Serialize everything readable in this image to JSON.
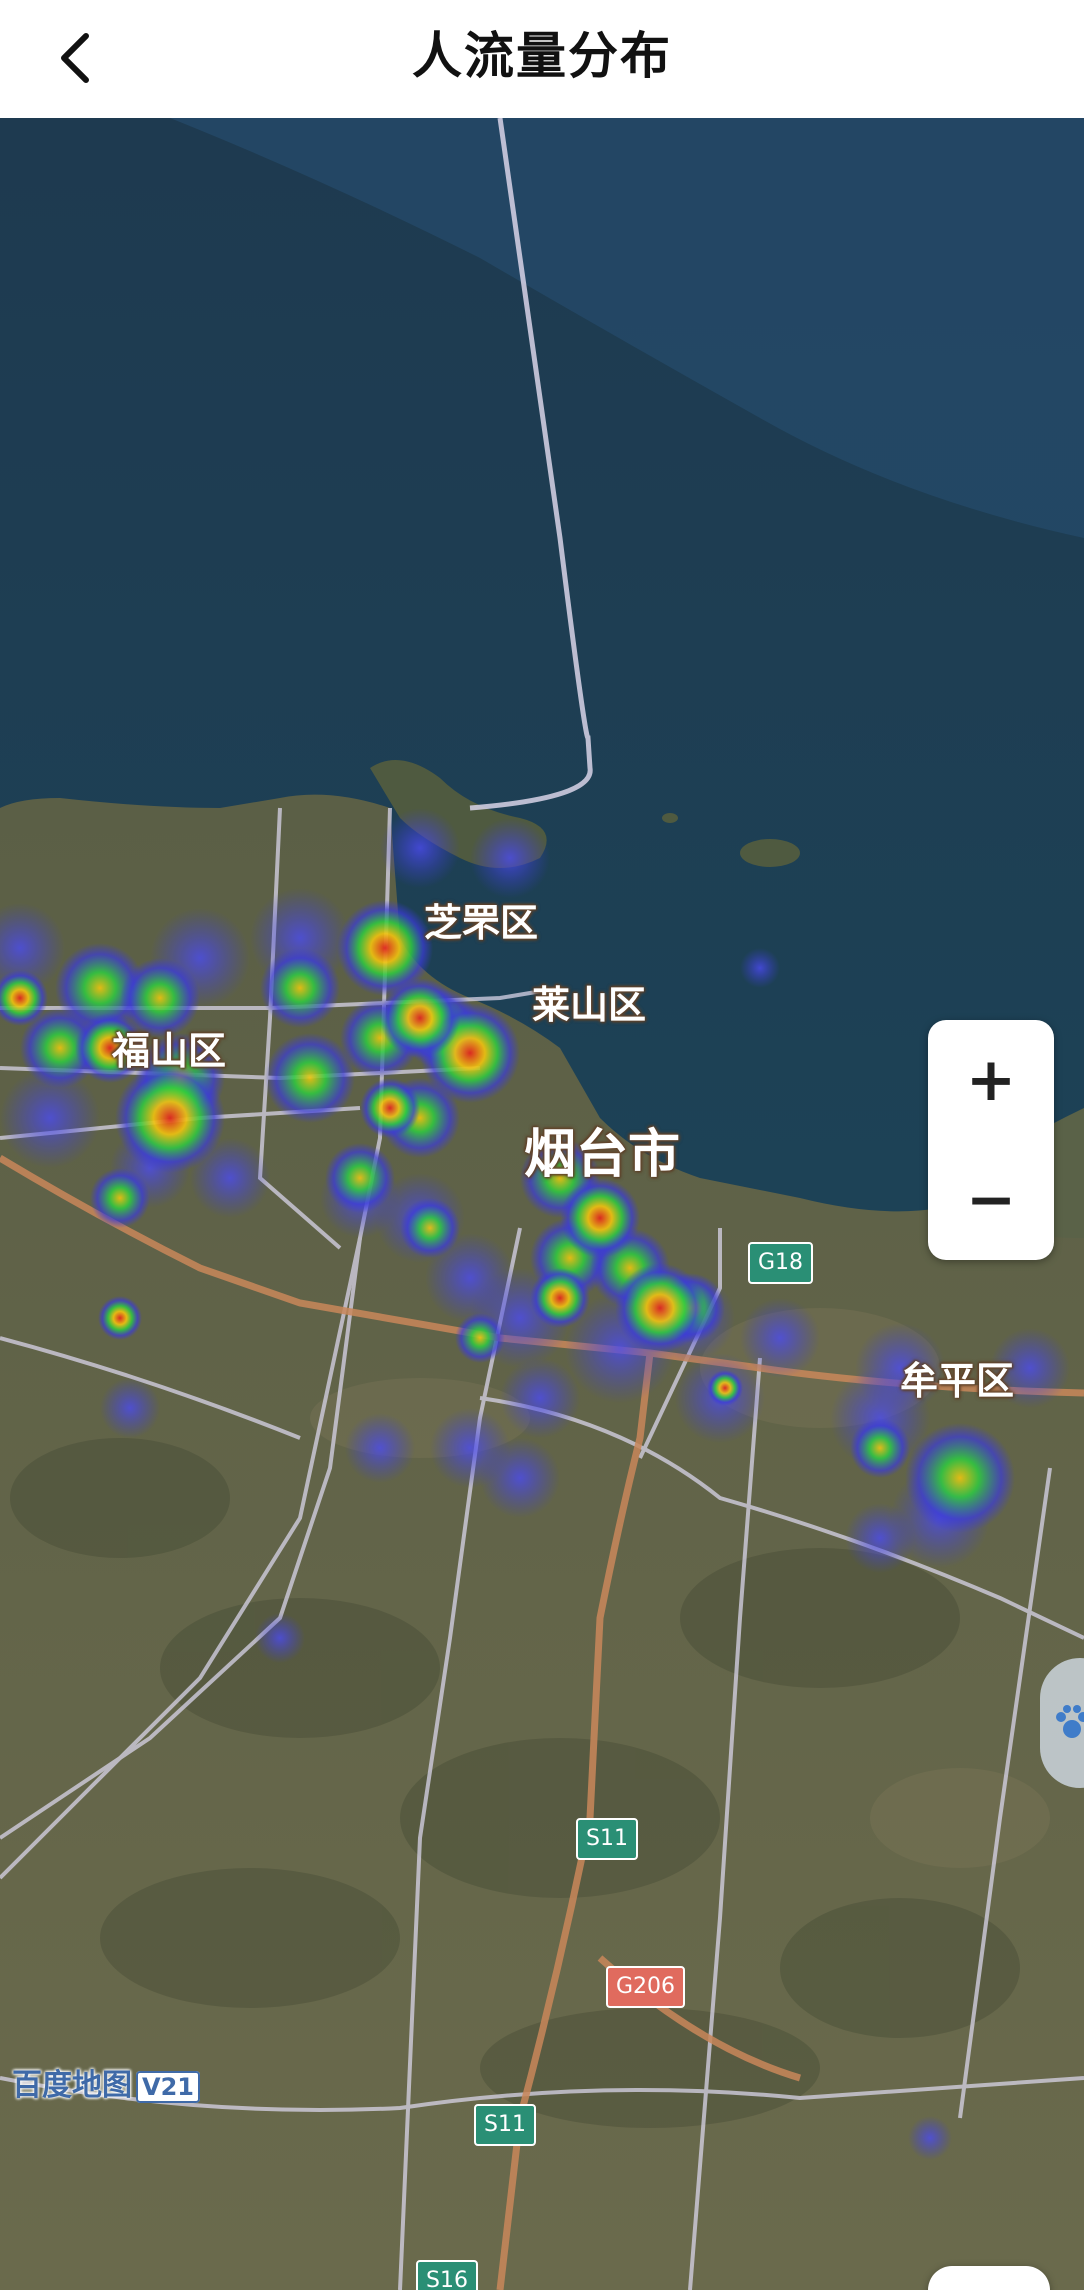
{
  "header": {
    "title": "人流量分布"
  },
  "map": {
    "labels": {
      "zhifu": "芝罘区",
      "laishan": "莱山区",
      "fushan": "福山区",
      "yantai": "烟台市",
      "muping": "牟平区"
    },
    "shields": {
      "g18": "G18",
      "s11_a": "S11",
      "g206": "G206",
      "s11_b": "S11",
      "s16": "S16"
    },
    "watermark": {
      "brand": "百度地图",
      "version": "V21"
    },
    "controls": {
      "zoom_in": "+",
      "zoom_out": "−"
    }
  },
  "colors": {
    "sea": "#1f3d52",
    "land": "#5d6042",
    "heat_low": "#3b3bd9",
    "heat_mid": "#2ecc40",
    "heat_high": "#f1c40f",
    "heat_peak": "#e0281f",
    "highway": "#c9875a",
    "road": "#d8d4e8"
  }
}
